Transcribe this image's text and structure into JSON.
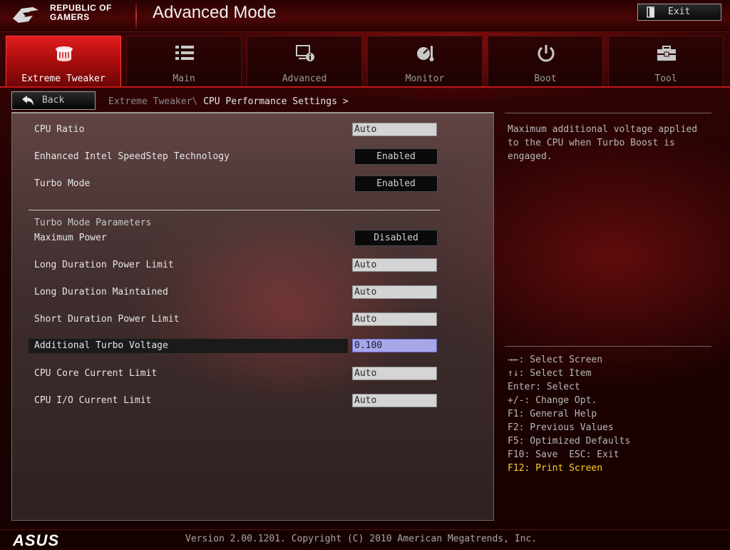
{
  "header": {
    "brand_line1": "REPUBLIC OF",
    "brand_line2": "GAMERS",
    "title": "Advanced Mode",
    "exit_label": "Exit"
  },
  "tabs": [
    {
      "label": "Extreme Tweaker",
      "icon": "tweaker-icon",
      "active": true
    },
    {
      "label": "Main",
      "icon": "list-icon",
      "active": false
    },
    {
      "label": "Advanced",
      "icon": "advanced-icon",
      "active": false
    },
    {
      "label": "Monitor",
      "icon": "monitor-gauge-icon",
      "active": false
    },
    {
      "label": "Boot",
      "icon": "power-icon",
      "active": false
    },
    {
      "label": "Tool",
      "icon": "toolbox-icon",
      "active": false
    }
  ],
  "nav": {
    "back_label": "Back",
    "breadcrumb_parent": "Extreme Tweaker\\ ",
    "breadcrumb_current": "CPU Performance Settings",
    "breadcrumb_suffix": " >"
  },
  "settings": [
    {
      "label": "CPU Ratio",
      "value": "Auto",
      "kind": "input"
    },
    {
      "label": "Enhanced Intel SpeedStep Technology",
      "value": "Enabled",
      "kind": "select"
    },
    {
      "label": "Turbo Mode",
      "value": "Enabled",
      "kind": "select"
    },
    {
      "label": "Maximum Power",
      "value": "Disabled",
      "kind": "select"
    },
    {
      "label": "Long Duration Power Limit",
      "value": "Auto",
      "kind": "input"
    },
    {
      "label": "Long Duration Maintained",
      "value": "Auto",
      "kind": "input"
    },
    {
      "label": "Short Duration Power Limit",
      "value": "Auto",
      "kind": "input"
    },
    {
      "label": "Additional Turbo Voltage",
      "value": "0.100",
      "kind": "input",
      "selected": true
    },
    {
      "label": "CPU Core Current Limit",
      "value": "Auto",
      "kind": "input"
    },
    {
      "label": "CPU I/O Current Limit",
      "value": "Auto",
      "kind": "input"
    }
  ],
  "section": {
    "title": "Turbo Mode Parameters"
  },
  "help": {
    "description": "Maximum additional voltage applied to the CPU when Turbo Boost is engaged."
  },
  "keys": [
    "→←: Select Screen",
    "↑↓: Select Item",
    "Enter: Select",
    "+/-: Change Opt.",
    "F1: General Help",
    "F2: Previous Values",
    "F5: Optimized Defaults",
    "F10: Save  ESC: Exit",
    "F12: Print Screen"
  ],
  "footer": {
    "brand": "ASUS",
    "version": "Version 2.00.1201. Copyright (C) 2010 American Megatrends, Inc."
  },
  "colors": {
    "accent_red": "#e01c1c",
    "focus_field": "#a8a8e8",
    "hotkey_highlight": "#ffd020"
  }
}
